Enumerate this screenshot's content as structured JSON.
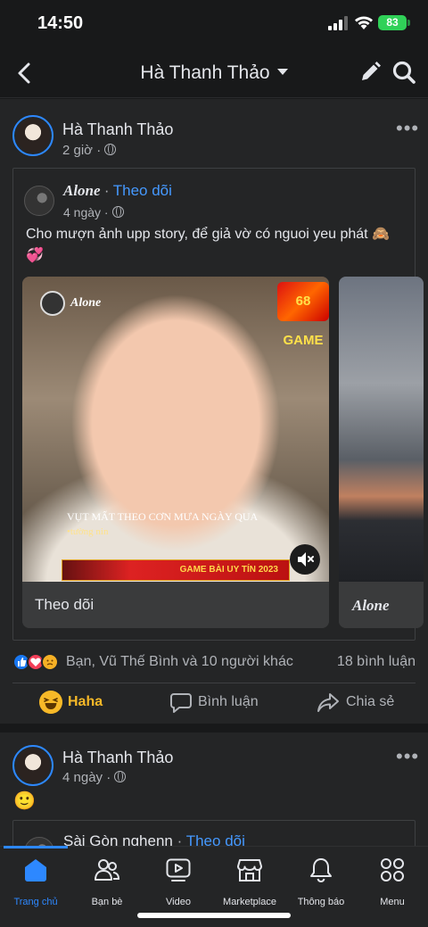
{
  "status_bar": {
    "time": "14:50",
    "battery": "83"
  },
  "top_nav": {
    "title": "Hà Thanh Thảo"
  },
  "post1": {
    "author": "Hà Thanh Thảo",
    "time": "2 giờ",
    "more": "•••",
    "shared": {
      "author": "Alone",
      "separator": "·",
      "follow": "Theo dõi",
      "time": "4 ngày",
      "text": "Cho mượn ảnh upp story, để giả vờ có nguoi yeu phát 🙈 💞",
      "cards": [
        {
          "watermark_name": "Alone",
          "badge": "68 GAME",
          "caption": "VỤT MẤT THEO CƠN MƯA NGÀY QUA",
          "caption_sub": "•tường nin",
          "banner": "GAME BÀI UY TÍN 2023",
          "footer": "Theo dõi"
        },
        {
          "footer": "Alone"
        }
      ]
    },
    "reactions_text": "Bạn, Vũ Thế Bình và 10 người khác",
    "comment_count": "18 bình luận",
    "actions": {
      "haha": "Haha",
      "comment": "Bình luận",
      "share": "Chia sẻ"
    }
  },
  "post2": {
    "author": "Hà Thanh Thảo",
    "time": "4 ngày",
    "emoji": "🙂",
    "more": "•••",
    "shared": {
      "author": "Sài Gòn nghenn",
      "separator": "·",
      "follow": "Theo dõi"
    }
  },
  "tabs": [
    {
      "label": "Trang chủ",
      "icon": "home-icon",
      "active": true
    },
    {
      "label": "Bạn bè",
      "icon": "friends-icon"
    },
    {
      "label": "Video",
      "icon": "video-icon"
    },
    {
      "label": "Marketplace",
      "icon": "marketplace-icon"
    },
    {
      "label": "Thông báo",
      "icon": "bell-icon"
    },
    {
      "label": "Menu",
      "icon": "menu-grid-icon"
    }
  ],
  "colors": {
    "accent": "#2d88ff",
    "follow": "#4599ff",
    "haha": "#f7b928",
    "background": "#18191a",
    "surface": "#242526"
  }
}
